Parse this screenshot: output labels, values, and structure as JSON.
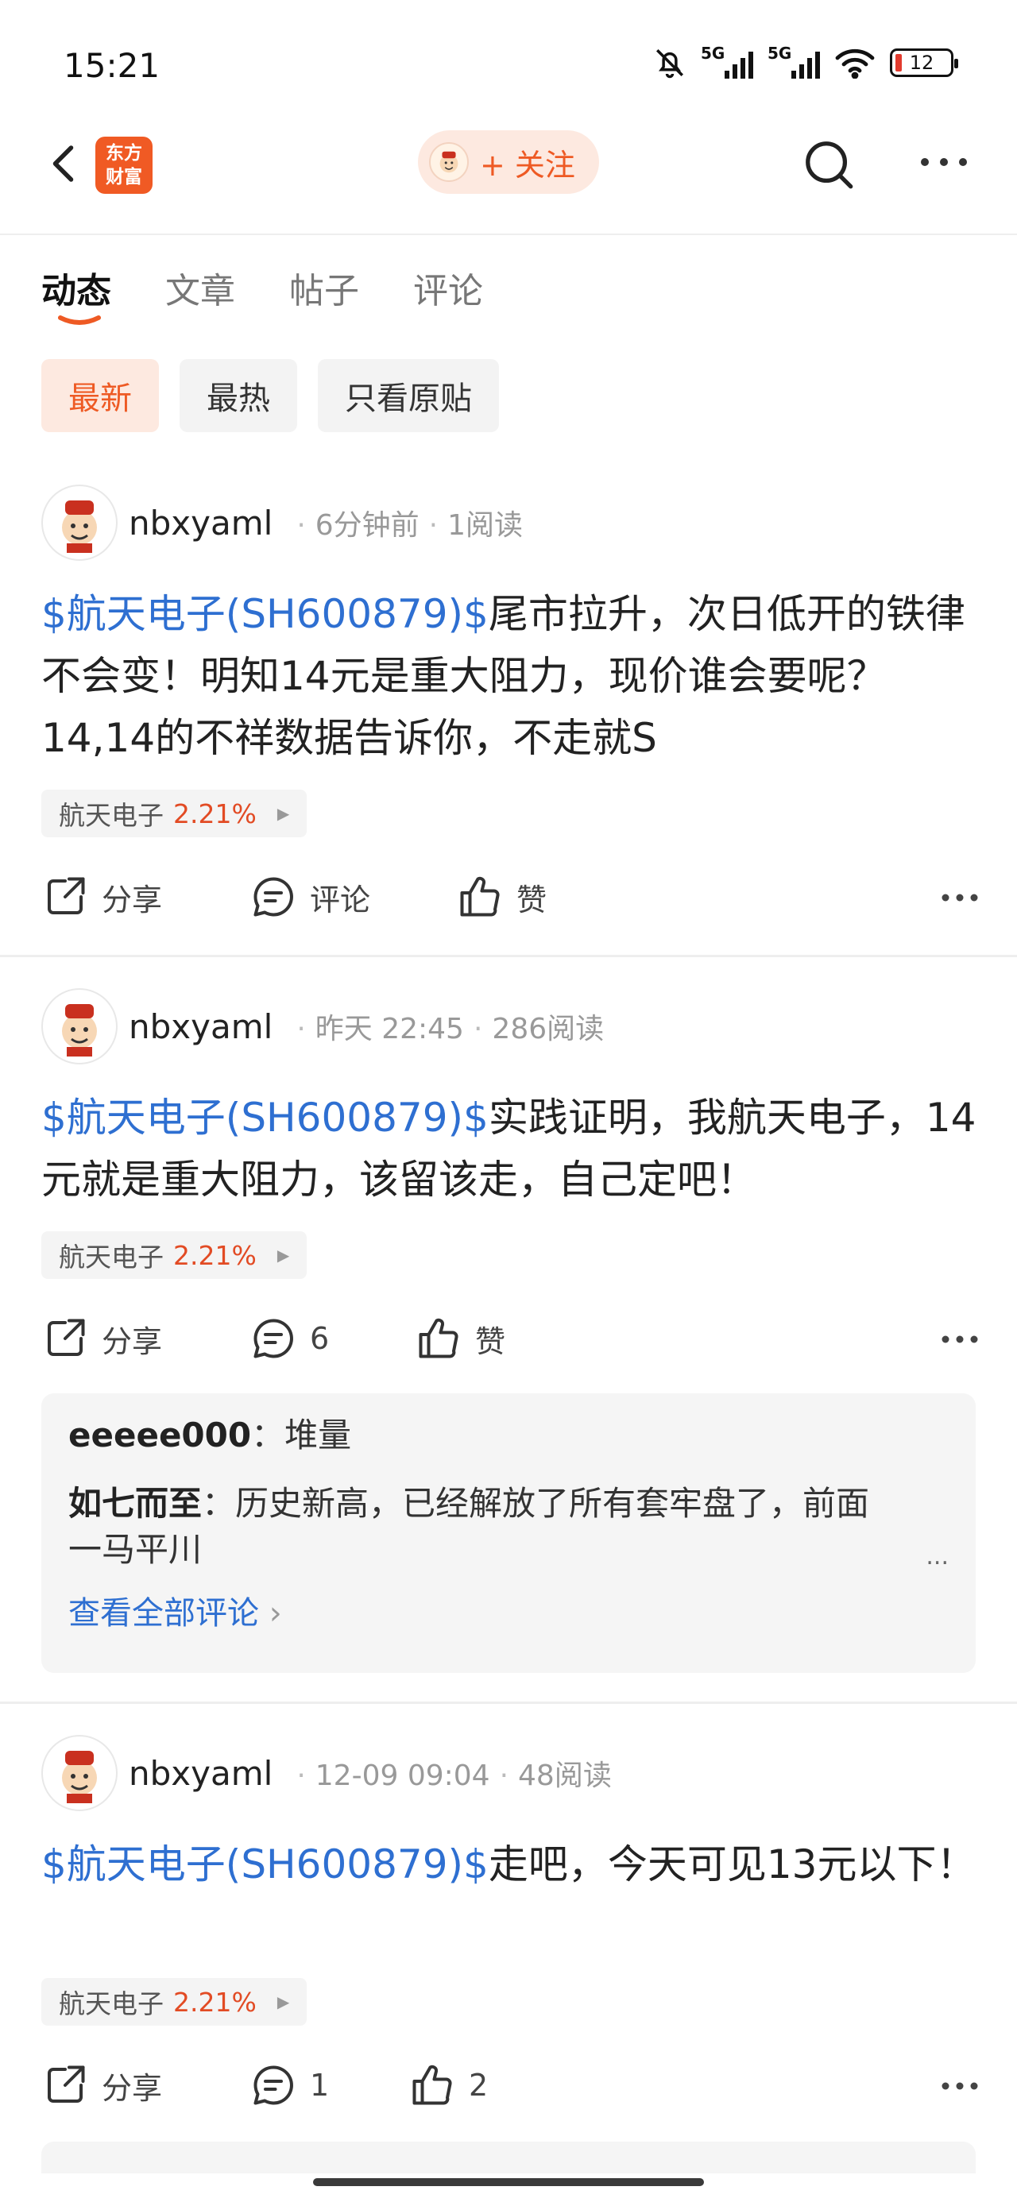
{
  "status_bar": {
    "time": "15:21",
    "signal_label_1": "5G",
    "signal_label_2": "5G",
    "battery": "12",
    "icons": [
      "bell-off-icon",
      "signal-icon",
      "signal-icon",
      "wifi-icon",
      "battery-icon"
    ]
  },
  "nav": {
    "logo_line1": "东方",
    "logo_line2": "财富",
    "follow_label": "+ 关注",
    "icons": [
      "back-icon",
      "search-icon",
      "more-icon"
    ]
  },
  "tabs": [
    {
      "label": "动态",
      "active": true
    },
    {
      "label": "文章",
      "active": false
    },
    {
      "label": "帖子",
      "active": false
    },
    {
      "label": "评论",
      "active": false
    }
  ],
  "filters": [
    {
      "label": "最新",
      "active": true
    },
    {
      "label": "最热",
      "active": false
    },
    {
      "label": "只看原贴",
      "active": false
    }
  ],
  "colors": {
    "accent": "#ee5a24",
    "stock_link": "#2e6fd1",
    "up": "#e24b24"
  },
  "posts": [
    {
      "user": "nbxyaml",
      "time": "6分钟前",
      "reads": "1阅读",
      "stock": "$航天电子(SH600879)$",
      "text": "尾市拉升，次日低开的铁律不会变！明知14元是重大阻力，现价谁会要呢？14,14的不祥数据告诉你，不走就S",
      "tag_name": "航天电子",
      "tag_pct": "2.21%",
      "share": "分享",
      "comment": "评论",
      "like": "赞"
    },
    {
      "user": "nbxyaml",
      "time": "昨天 22:45",
      "reads": "286阅读",
      "stock": "$航天电子(SH600879)$",
      "text": "实践证明，我航天电子，14元就是重大阻力，该留该走，自己定吧！",
      "tag_name": "航天电子",
      "tag_pct": "2.21%",
      "share": "分享",
      "comment": "6",
      "like": "赞",
      "comments": [
        {
          "user": "eeeee000",
          "text": "堆量"
        },
        {
          "user": "如七而至",
          "text": "历史新高，已经解放了所有套牢盘了，前面一马平川"
        }
      ],
      "view_all": "查看全部评论",
      "ellipsis": "..."
    },
    {
      "user": "nbxyaml",
      "time": "12-09 09:04",
      "reads": "48阅读",
      "stock": "$航天电子(SH600879)$",
      "text": "走吧，今天可见13元以下！",
      "tag_name": "航天电子",
      "tag_pct": "2.21%",
      "share": "分享",
      "comment": "1",
      "like": "2"
    }
  ]
}
